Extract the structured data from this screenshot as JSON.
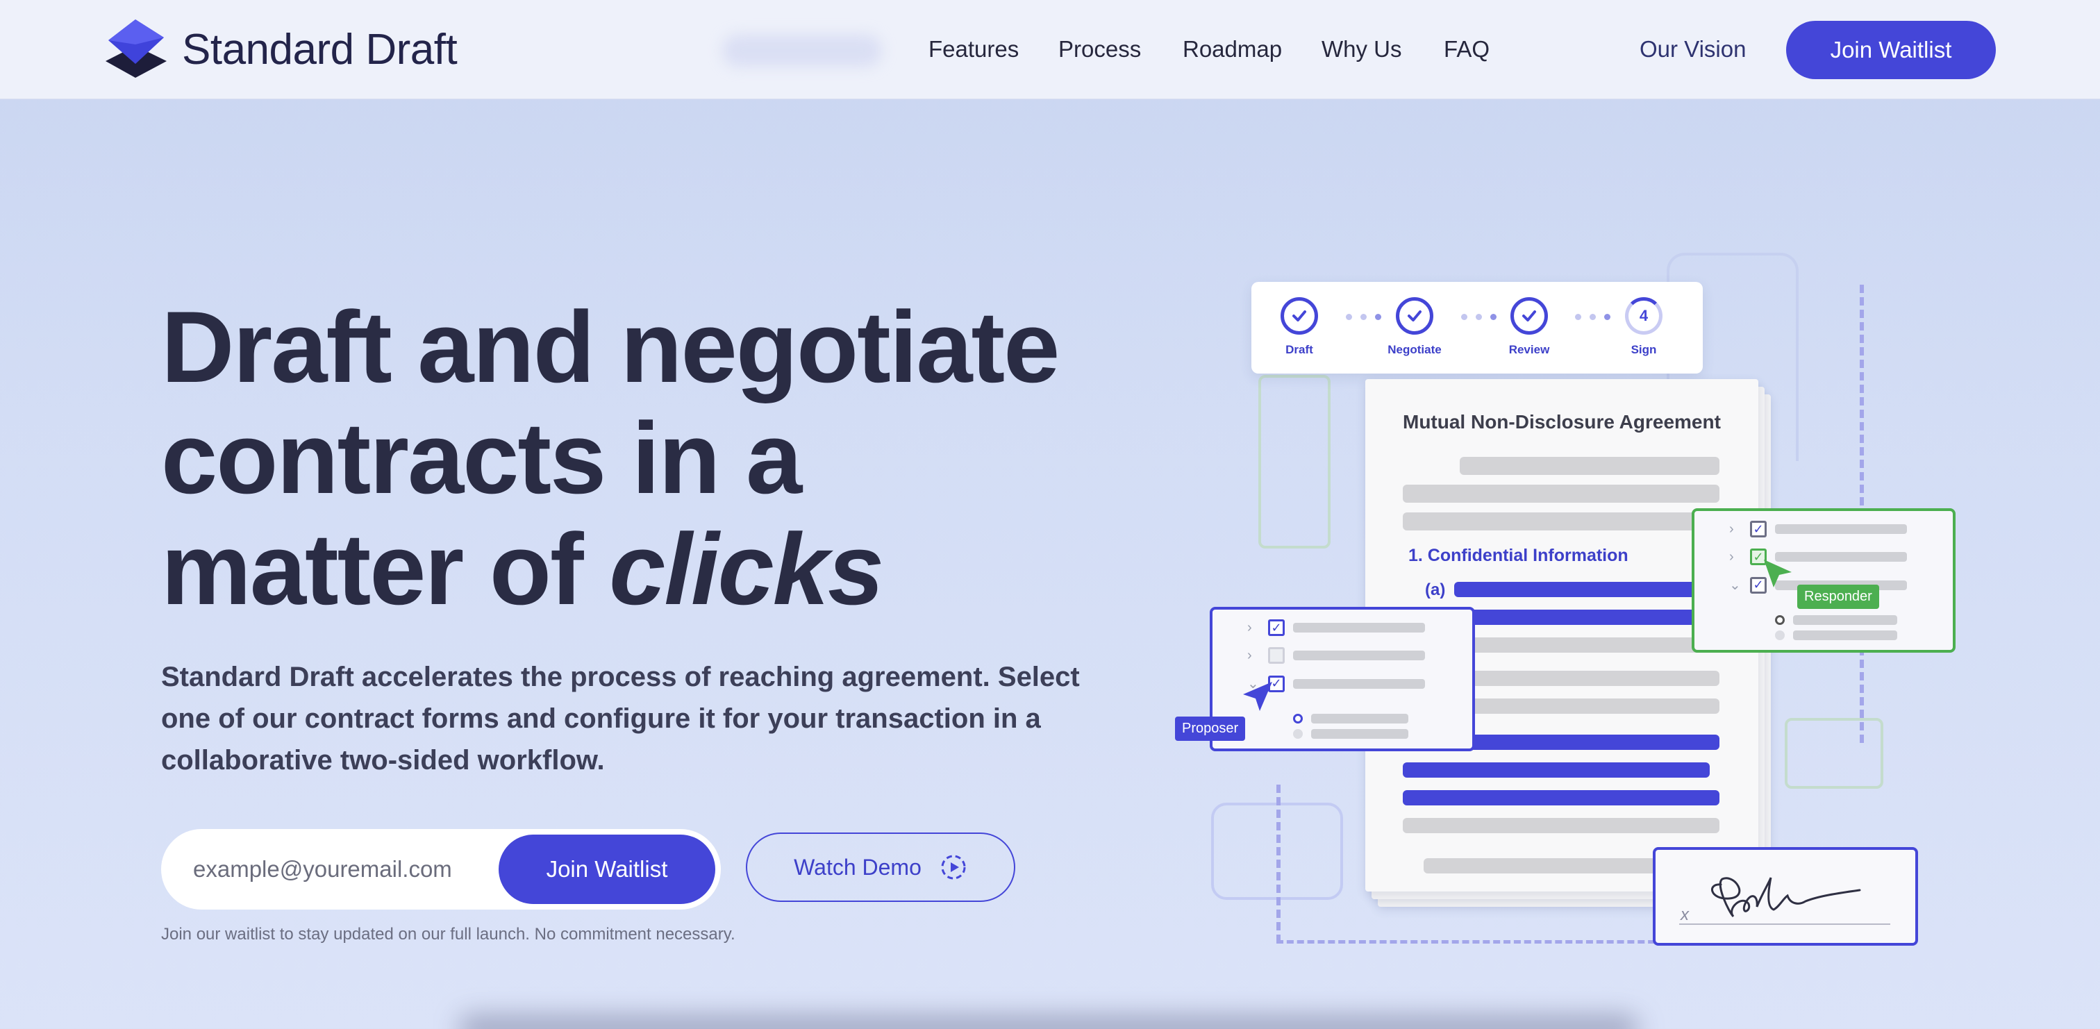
{
  "header": {
    "brand": "Standard Draft",
    "nav": [
      "Features",
      "Process",
      "Roadmap",
      "Why Us",
      "FAQ"
    ],
    "vision_link": "Our Vision",
    "cta": "Join Waitlist"
  },
  "hero": {
    "headline_line1": "Draft and negotiate",
    "headline_line2": "contracts in a",
    "headline_line3_prefix": "matter of ",
    "headline_emphasis": "clicks",
    "subtext": "Standard Draft accelerates the process of reaching agreement. Select one of our contract forms and configure it for your transaction in a collaborative two-sided workflow.",
    "email_placeholder": "example@youremail.com",
    "form_cta": "Join Waitlist",
    "demo_label": "Watch Demo",
    "note": "Join our waitlist to stay updated on our full launch. No commitment necessary."
  },
  "illustration": {
    "steps": [
      {
        "label": "Draft",
        "state": "done"
      },
      {
        "label": "Negotiate",
        "state": "done"
      },
      {
        "label": "Review",
        "state": "done"
      },
      {
        "label": "Sign",
        "state": "current",
        "number": "4"
      }
    ],
    "document_title": "Mutual Non-Disclosure Agreement",
    "section_label": "1. Confidential Information",
    "subsection_label": "(a)",
    "proposer_tag": "Proposer",
    "responder_tag": "Responder",
    "signature_mark": "x"
  },
  "colors": {
    "accent": "#4446d8",
    "responder": "#4caf50",
    "heading": "#2a2c44"
  }
}
